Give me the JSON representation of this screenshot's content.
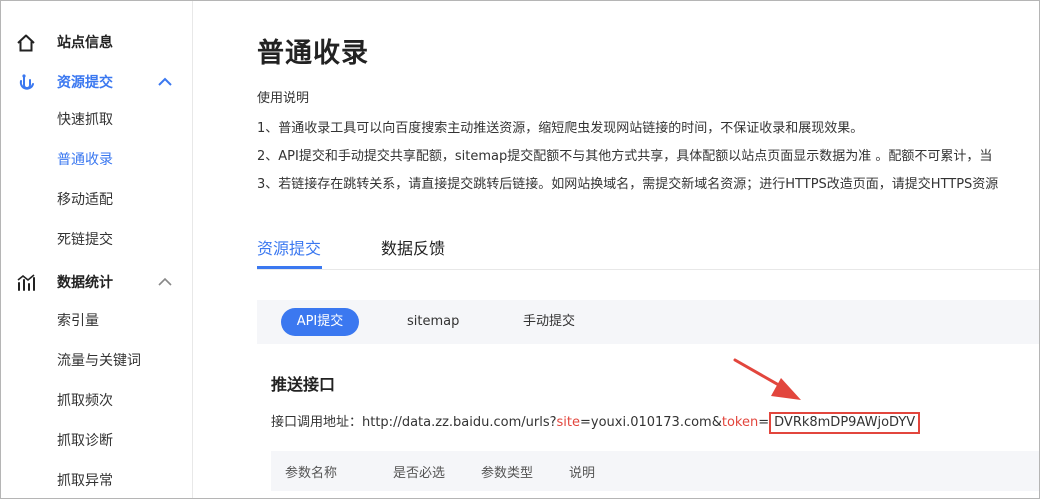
{
  "sidebar": {
    "site_info": "站点信息",
    "resource_submit": "资源提交",
    "resource_items": [
      "快速抓取",
      "普通收录",
      "移动适配",
      "死链提交"
    ],
    "data_stats": "数据统计",
    "stats_items": [
      "索引量",
      "流量与关键词",
      "抓取频次",
      "抓取诊断",
      "抓取异常"
    ]
  },
  "main": {
    "title": "普通收录",
    "usage_title": "使用说明",
    "usage_lines": [
      "1、普通收录工具可以向百度搜索主动推送资源，缩短爬虫发现网站链接的时间，不保证收录和展现效果。",
      "2、API提交和手动提交共享配额，sitemap提交配额不与其他方式共享，具体配额以站点页面显示数据为准 。配额不可累计，当",
      "3、若链接存在跳转关系，请直接提交跳转后链接。如网站换域名，需提交新域名资源；进行HTTPS改造页面，请提交HTTPS资源"
    ],
    "tabs": [
      "资源提交",
      "数据反馈"
    ],
    "segments": [
      "API提交",
      "sitemap",
      "手动提交"
    ],
    "push_title": "推送接口",
    "api": {
      "prefix": "接口调用地址：http://data.zz.baidu.com/urls?",
      "site_key": "site",
      "site_value": "=youxi.010173.com&",
      "token_key": "token",
      "equals": "=",
      "token_value": "DVRk8mDP9AWjoDYV"
    },
    "table_headers": [
      "参数名称",
      "是否必选",
      "参数类型",
      "说明"
    ]
  },
  "colors": {
    "accent": "#3b78f0",
    "highlight": "#e2463d"
  }
}
